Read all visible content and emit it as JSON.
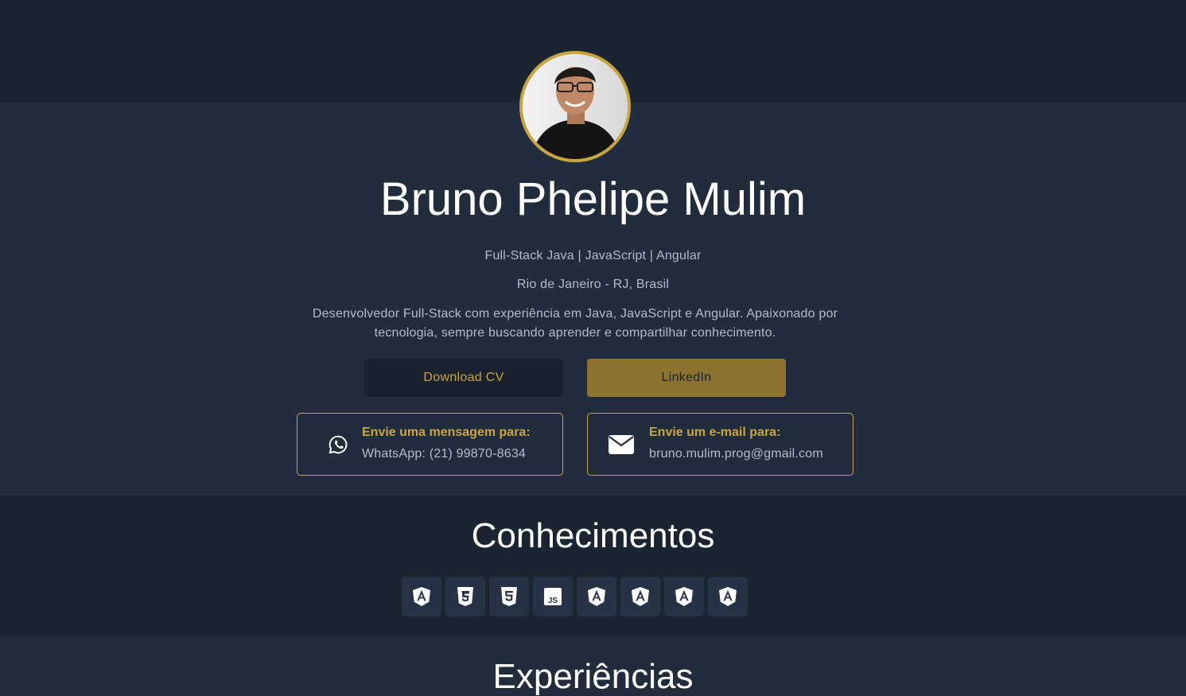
{
  "profile": {
    "name": "Bruno Phelipe Mulim",
    "subtitle": "Full-Stack Java | JavaScript | Angular",
    "location": "Rio de Janeiro - RJ, Brasil",
    "bio": "Desenvolvedor Full-Stack com experiência em Java, JavaScript e Angular. Apaixonado por tecnologia, sempre buscando aprender e compartilhar conhecimento."
  },
  "buttons": {
    "download_cv": "Download CV",
    "linkedin": "LinkedIn"
  },
  "contacts": {
    "whatsapp": {
      "title": "Envie uma mensagem para:",
      "value": "WhatsApp: (21) 99870-8634",
      "icon": "whatsapp-icon"
    },
    "email": {
      "title": "Envie um e-mail para:",
      "value": "bruno.mulim.prog@gmail.com",
      "icon": "envelope-icon"
    }
  },
  "sections": {
    "skills_title": "Conhecimentos",
    "experience_title": "Experiências"
  },
  "skills": [
    "angular-icon",
    "css3-icon",
    "html5-icon",
    "javascript-icon",
    "angular-icon",
    "angular-icon",
    "angular-icon",
    "angular-icon"
  ],
  "colors": {
    "background_dark": "#1b2431",
    "background_light": "#212c3d",
    "accent_gold": "#c9a53f",
    "linkedin_button": "#8c7330",
    "skill_tile": "#263245"
  }
}
